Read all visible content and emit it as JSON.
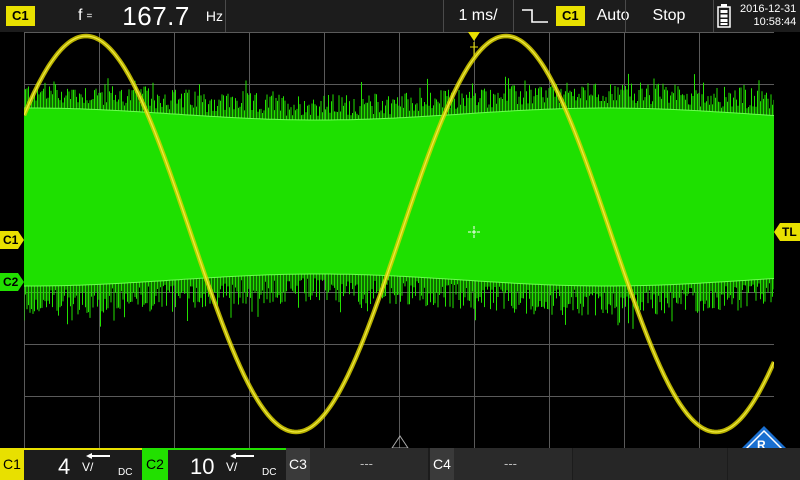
{
  "colors": {
    "ch1": "#e8e000",
    "ch2": "#22e000",
    "grid": "#5a5a5a",
    "bar": "#1c1c1c",
    "logo": "#1a6fd0"
  },
  "topbar": {
    "channel_badge": "C1",
    "freq_label": "f",
    "freq_value": "167.7",
    "freq_unit": "Hz",
    "timebase": "1 ms/",
    "trigger_channel": "C1",
    "trigger_mode": "Auto",
    "run_state": "Stop",
    "date": "2016-12-31",
    "time": "10:58:44"
  },
  "markers": {
    "ch1": "C1",
    "ch2": "C2",
    "trigger_level": "TL"
  },
  "bottombar": {
    "ch1": {
      "label": "C1",
      "scale": "4",
      "unit": "V/",
      "coupling": "DC"
    },
    "ch2": {
      "label": "C2",
      "scale": "10",
      "unit": "V/",
      "coupling": "DC"
    },
    "ch3": {
      "label": "C3",
      "value": "---"
    },
    "ch4": {
      "label": "C4",
      "value": "---"
    }
  },
  "icons": [
    "falling-edge-trigger-icon",
    "battery-icon",
    "trigger-position-icon",
    "center-crosshair-icon",
    "rohde-schwarz-logo-icon"
  ]
}
